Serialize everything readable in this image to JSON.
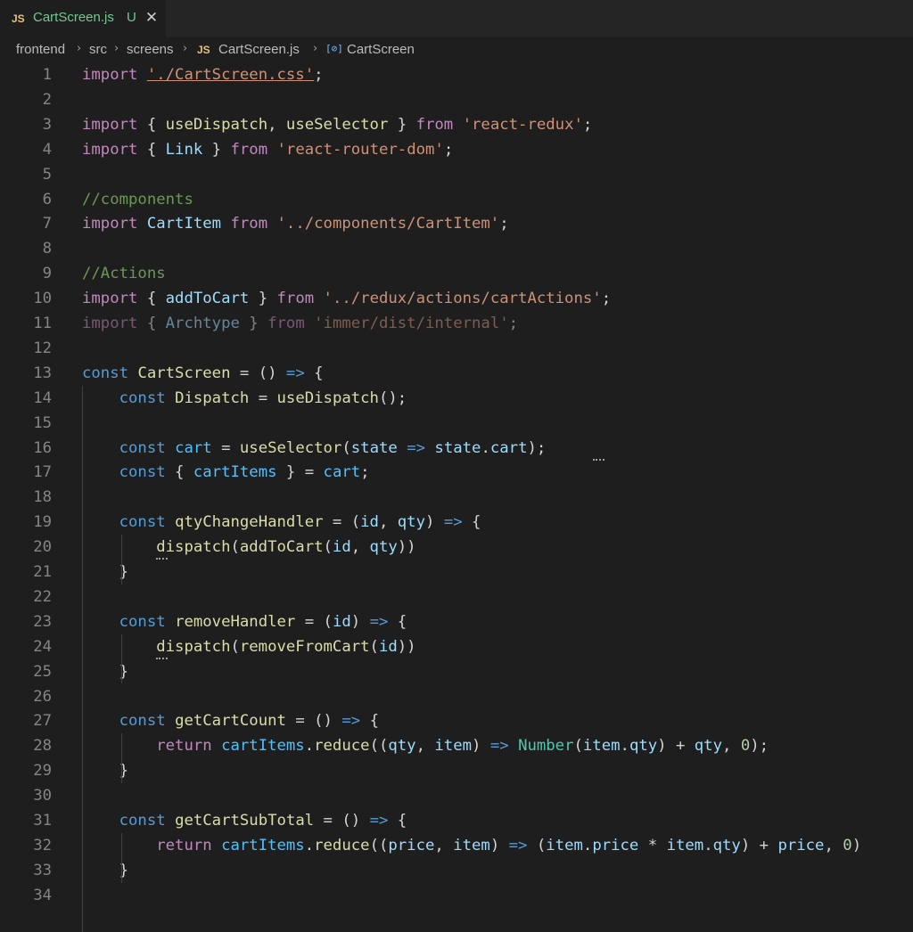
{
  "tab": {
    "lang_badge": "JS",
    "filename": "CartScreen.js",
    "status": "U",
    "close_glyph": "✕"
  },
  "breadcrumb": {
    "items": [
      "frontend",
      "src",
      "screens",
      "CartScreen.js",
      "CartScreen"
    ],
    "file_badge": "JS",
    "symbol_glyph": "[⊘]",
    "separator": "›"
  },
  "colors": {
    "background": "#1e1e1e",
    "keyword_control": "#c586c0",
    "string": "#ce9178",
    "variable": "#9cdcfe",
    "constant": "#4fc1ff",
    "function": "#dcdcaa",
    "storage": "#569cd6",
    "comment": "#6a9955",
    "type": "#4ec9b0"
  },
  "code": {
    "lines": [
      {
        "number": "1",
        "tokens": [
          [
            "k",
            "import"
          ],
          [
            "p",
            " "
          ],
          [
            "sl",
            "'./CartScreen.css'"
          ],
          [
            "p",
            ";"
          ]
        ]
      },
      {
        "number": "2",
        "tokens": []
      },
      {
        "number": "3",
        "tokens": [
          [
            "k",
            "import"
          ],
          [
            "p",
            " { "
          ],
          [
            "f",
            "useDispatch"
          ],
          [
            "p",
            ", "
          ],
          [
            "f",
            "useSelector"
          ],
          [
            "p",
            " } "
          ],
          [
            "k",
            "from"
          ],
          [
            "p",
            " "
          ],
          [
            "s",
            "'react-redux'"
          ],
          [
            "p",
            ";"
          ]
        ]
      },
      {
        "number": "4",
        "tokens": [
          [
            "k",
            "import"
          ],
          [
            "p",
            " { "
          ],
          [
            "v",
            "Link"
          ],
          [
            "p",
            " } "
          ],
          [
            "k",
            "from"
          ],
          [
            "p",
            " "
          ],
          [
            "s",
            "'react-router-dom'"
          ],
          [
            "p",
            ";"
          ]
        ]
      },
      {
        "number": "5",
        "tokens": []
      },
      {
        "number": "6",
        "tokens": [
          [
            "cm",
            "//components"
          ]
        ]
      },
      {
        "number": "7",
        "tokens": [
          [
            "k",
            "import"
          ],
          [
            "p",
            " "
          ],
          [
            "v",
            "CartItem"
          ],
          [
            "p",
            " "
          ],
          [
            "k",
            "from"
          ],
          [
            "p",
            " "
          ],
          [
            "s",
            "'../components/CartItem'"
          ],
          [
            "p",
            ";"
          ]
        ]
      },
      {
        "number": "8",
        "tokens": []
      },
      {
        "number": "9",
        "tokens": [
          [
            "cm",
            "//Actions"
          ]
        ]
      },
      {
        "number": "10",
        "tokens": [
          [
            "k",
            "import"
          ],
          [
            "p",
            " { "
          ],
          [
            "v",
            "addToCart"
          ],
          [
            "p",
            " } "
          ],
          [
            "k",
            "from"
          ],
          [
            "p",
            " "
          ],
          [
            "s",
            "'../redux/actions/cartActions'"
          ],
          [
            "p",
            ";"
          ]
        ]
      },
      {
        "number": "11",
        "dim": true,
        "tokens": [
          [
            "k",
            "import"
          ],
          [
            "p",
            " { "
          ],
          [
            "v",
            "Archtype"
          ],
          [
            "p",
            " } "
          ],
          [
            "k",
            "from"
          ],
          [
            "p",
            " "
          ],
          [
            "s",
            "'immer/dist/internal'"
          ],
          [
            "p",
            ";"
          ]
        ]
      },
      {
        "number": "12",
        "tokens": []
      },
      {
        "number": "13",
        "tokens": [
          [
            "d",
            "const"
          ],
          [
            "p",
            " "
          ],
          [
            "f",
            "CartScreen"
          ],
          [
            "p",
            " = () "
          ],
          [
            "d",
            "=>"
          ],
          [
            "p",
            " {"
          ]
        ]
      },
      {
        "number": "14",
        "tokens": [
          [
            "p",
            "    "
          ],
          [
            "d",
            "const"
          ],
          [
            "p",
            " "
          ],
          [
            "f",
            "Dispatch"
          ],
          [
            "p",
            " = "
          ],
          [
            "f",
            "useDispatch"
          ],
          [
            "p",
            "();"
          ]
        ]
      },
      {
        "number": "15",
        "tokens": []
      },
      {
        "number": "16",
        "tokens": [
          [
            "p",
            "    "
          ],
          [
            "d",
            "const"
          ],
          [
            "p",
            " "
          ],
          [
            "c",
            "cart"
          ],
          [
            "p",
            " = "
          ],
          [
            "f",
            "useSelector"
          ],
          [
            "p",
            "("
          ],
          [
            "v",
            "state"
          ],
          [
            "p",
            " "
          ],
          [
            "d",
            "=>"
          ],
          [
            "p",
            " "
          ],
          [
            "v",
            "state"
          ],
          [
            "p",
            "."
          ],
          [
            "v",
            "cart"
          ],
          [
            "p",
            ");"
          ]
        ]
      },
      {
        "number": "17",
        "tokens": [
          [
            "p",
            "    "
          ],
          [
            "d",
            "const"
          ],
          [
            "p",
            " { "
          ],
          [
            "c",
            "cartItems"
          ],
          [
            "p",
            " } = "
          ],
          [
            "c",
            "cart"
          ],
          [
            "p",
            ";"
          ]
        ]
      },
      {
        "number": "18",
        "tokens": []
      },
      {
        "number": "19",
        "tokens": [
          [
            "p",
            "    "
          ],
          [
            "d",
            "const"
          ],
          [
            "p",
            " "
          ],
          [
            "f",
            "qtyChangeHandler"
          ],
          [
            "p",
            " = ("
          ],
          [
            "v",
            "id"
          ],
          [
            "p",
            ", "
          ],
          [
            "v",
            "qty"
          ],
          [
            "p",
            ") "
          ],
          [
            "d",
            "=>"
          ],
          [
            "p",
            " {"
          ]
        ]
      },
      {
        "number": "20",
        "tokens": [
          [
            "p",
            "        "
          ],
          [
            "f",
            "dispatch"
          ],
          [
            "p",
            "("
          ],
          [
            "f",
            "addToCart"
          ],
          [
            "p",
            "("
          ],
          [
            "v",
            "id"
          ],
          [
            "p",
            ", "
          ],
          [
            "v",
            "qty"
          ],
          [
            "p",
            "))"
          ]
        ]
      },
      {
        "number": "21",
        "tokens": [
          [
            "p",
            "    }"
          ]
        ]
      },
      {
        "number": "22",
        "tokens": []
      },
      {
        "number": "23",
        "tokens": [
          [
            "p",
            "    "
          ],
          [
            "d",
            "const"
          ],
          [
            "p",
            " "
          ],
          [
            "f",
            "removeHandler"
          ],
          [
            "p",
            " = ("
          ],
          [
            "v",
            "id"
          ],
          [
            "p",
            ") "
          ],
          [
            "d",
            "=>"
          ],
          [
            "p",
            " {"
          ]
        ]
      },
      {
        "number": "24",
        "tokens": [
          [
            "p",
            "        "
          ],
          [
            "f",
            "dispatch"
          ],
          [
            "p",
            "("
          ],
          [
            "f",
            "removeFromCart"
          ],
          [
            "p",
            "("
          ],
          [
            "v",
            "id"
          ],
          [
            "p",
            "))"
          ]
        ]
      },
      {
        "number": "25",
        "tokens": [
          [
            "p",
            "    }"
          ]
        ]
      },
      {
        "number": "26",
        "tokens": []
      },
      {
        "number": "27",
        "tokens": [
          [
            "p",
            "    "
          ],
          [
            "d",
            "const"
          ],
          [
            "p",
            " "
          ],
          [
            "f",
            "getCartCount"
          ],
          [
            "p",
            " = () "
          ],
          [
            "d",
            "=>"
          ],
          [
            "p",
            " {"
          ]
        ]
      },
      {
        "number": "28",
        "tokens": [
          [
            "p",
            "        "
          ],
          [
            "k",
            "return"
          ],
          [
            "p",
            " "
          ],
          [
            "c",
            "cartItems"
          ],
          [
            "p",
            "."
          ],
          [
            "f",
            "reduce"
          ],
          [
            "p",
            "(("
          ],
          [
            "v",
            "qty"
          ],
          [
            "p",
            ", "
          ],
          [
            "v",
            "item"
          ],
          [
            "p",
            ") "
          ],
          [
            "d",
            "=>"
          ],
          [
            "p",
            " "
          ],
          [
            "t",
            "Number"
          ],
          [
            "p",
            "("
          ],
          [
            "v",
            "item"
          ],
          [
            "p",
            "."
          ],
          [
            "v",
            "qty"
          ],
          [
            "p",
            ") + "
          ],
          [
            "v",
            "qty"
          ],
          [
            "p",
            ", "
          ],
          [
            "n",
            "0"
          ],
          [
            "p",
            ");"
          ]
        ]
      },
      {
        "number": "29",
        "tokens": [
          [
            "p",
            "    }"
          ]
        ]
      },
      {
        "number": "30",
        "tokens": []
      },
      {
        "number": "31",
        "tokens": [
          [
            "p",
            "    "
          ],
          [
            "d",
            "const"
          ],
          [
            "p",
            " "
          ],
          [
            "f",
            "getCartSubTotal"
          ],
          [
            "p",
            " = () "
          ],
          [
            "d",
            "=>"
          ],
          [
            "p",
            " {"
          ]
        ]
      },
      {
        "number": "32",
        "tokens": [
          [
            "p",
            "        "
          ],
          [
            "k",
            "return"
          ],
          [
            "p",
            " "
          ],
          [
            "c",
            "cartItems"
          ],
          [
            "p",
            "."
          ],
          [
            "f",
            "reduce"
          ],
          [
            "p",
            "(("
          ],
          [
            "v",
            "price"
          ],
          [
            "p",
            ", "
          ],
          [
            "v",
            "item"
          ],
          [
            "p",
            ") "
          ],
          [
            "d",
            "=>"
          ],
          [
            "p",
            " ("
          ],
          [
            "v",
            "item"
          ],
          [
            "p",
            "."
          ],
          [
            "v",
            "price"
          ],
          [
            "p",
            " * "
          ],
          [
            "v",
            "item"
          ],
          [
            "p",
            "."
          ],
          [
            "v",
            "qty"
          ],
          [
            "p",
            ") + "
          ],
          [
            "v",
            "price"
          ],
          [
            "p",
            ", "
          ],
          [
            "n",
            "0"
          ],
          [
            "p",
            ")"
          ]
        ]
      },
      {
        "number": "33",
        "tokens": [
          [
            "p",
            "    }"
          ]
        ]
      },
      {
        "number": "34",
        "tokens": []
      }
    ]
  }
}
